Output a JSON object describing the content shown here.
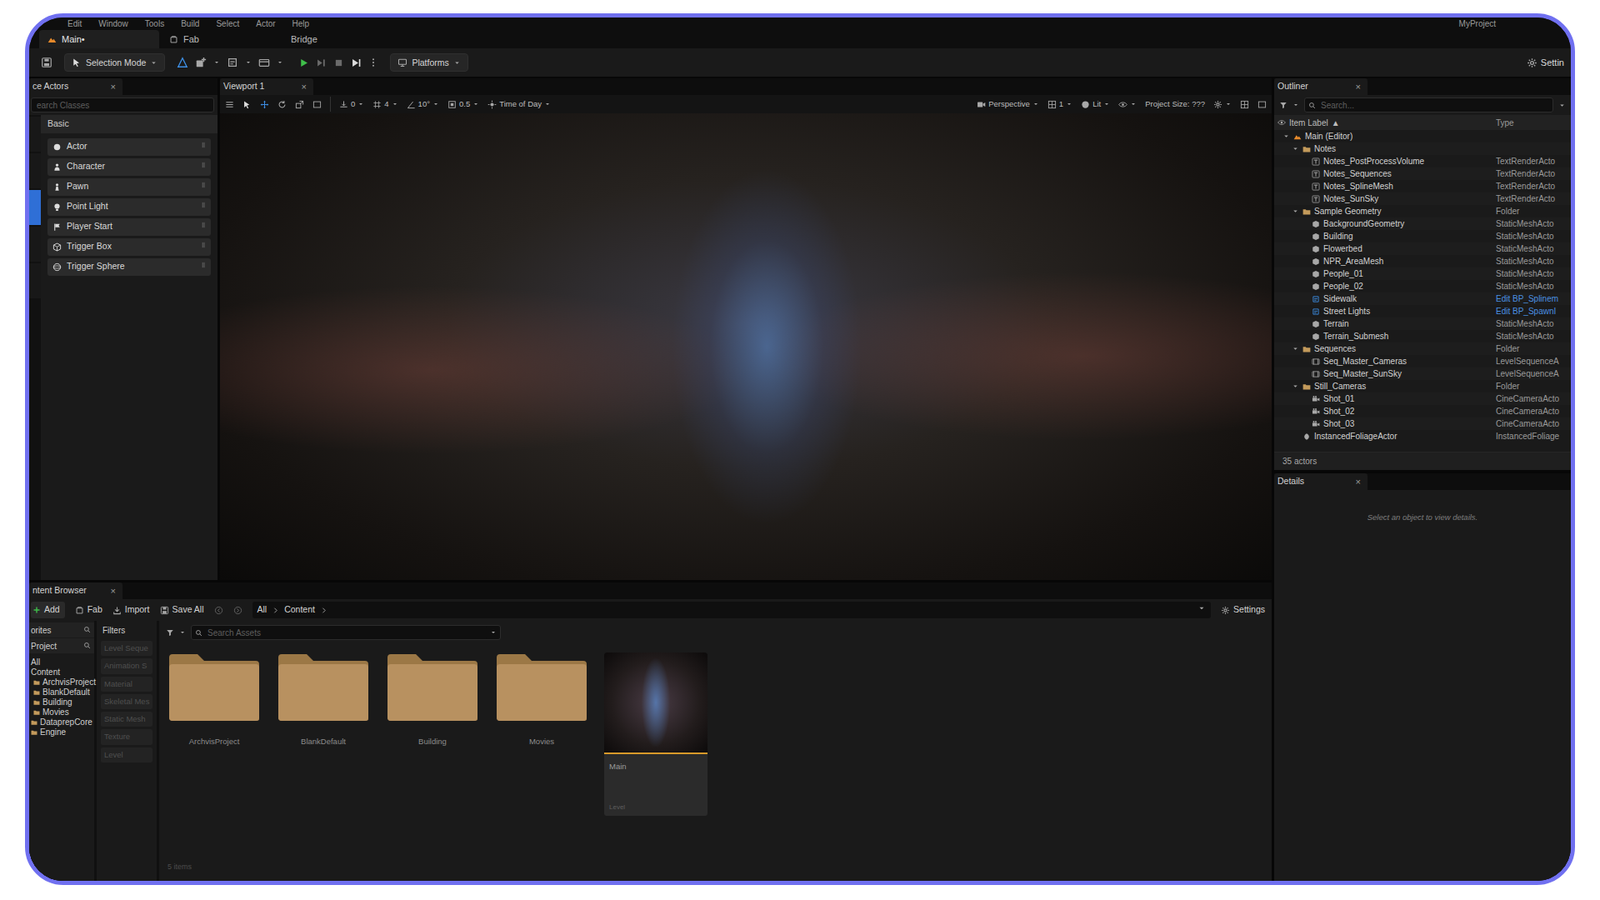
{
  "window": {
    "title": "MyProject"
  },
  "menu": [
    "Edit",
    "Window",
    "Tools",
    "Build",
    "Select",
    "Actor",
    "Help"
  ],
  "doc_tabs": [
    {
      "label": "Main•",
      "selected": true,
      "kind": "level"
    },
    {
      "label": "Fab",
      "selected": false,
      "kind": "fab"
    },
    {
      "label": "Bridge",
      "selected": false,
      "kind": "plain"
    }
  ],
  "toolbar": {
    "mode": "Selection Mode",
    "platforms": "Platforms",
    "settings": "Settin",
    "play_controls": [
      {
        "kind": "play",
        "disabled": false
      },
      {
        "kind": "step",
        "disabled": true
      },
      {
        "kind": "stop",
        "disabled": true
      },
      {
        "kind": "eject",
        "disabled": false
      }
    ]
  },
  "place_actors": {
    "tab": "ce Actors",
    "close": "×",
    "search_placeholder": "earch Classes",
    "category": "Basic",
    "modes": [
      {
        "selected": false
      },
      {
        "selected": false
      },
      {
        "selected": true
      },
      {
        "selected": false
      },
      {
        "selected": false
      }
    ],
    "items": [
      {
        "label": "Actor",
        "kind": "actor"
      },
      {
        "label": "Character",
        "kind": "character"
      },
      {
        "label": "Pawn",
        "kind": "pawn"
      },
      {
        "label": "Point Light",
        "kind": "light"
      },
      {
        "label": "Player Start",
        "kind": "playerstart"
      },
      {
        "label": "Trigger Box",
        "kind": "box"
      },
      {
        "label": "Trigger Sphere",
        "kind": "sphere"
      }
    ]
  },
  "viewport": {
    "tab": "Viewport 1",
    "close": "×",
    "surface_snap": "0",
    "grid_snap": "4",
    "rotate_snap": "10°",
    "scale_snap": "0.5",
    "time_of_day": "Time of Day",
    "view_mode": "Perspective",
    "view_count": "1",
    "lighting": "Lit",
    "project_size": "Project Size: ???"
  },
  "outliner": {
    "tab": "Outliner",
    "close": "×",
    "search_placeholder": "Search...",
    "columns": [
      "Item Label",
      "Type"
    ],
    "sort_glyph": "▲",
    "rows": [
      {
        "label": "Main (Editor)",
        "kind": "level",
        "depth": 0,
        "expanded": true,
        "type_link": false
      },
      {
        "label": "Notes",
        "kind": "folder",
        "depth": 1,
        "expanded": true,
        "type_link": false
      },
      {
        "label": "Notes_PostProcessVolume",
        "type": "TextRenderActo",
        "kind": "text",
        "depth": 2,
        "type_link": false
      },
      {
        "label": "Notes_Sequences",
        "type": "TextRenderActo",
        "kind": "text",
        "depth": 2,
        "type_link": false
      },
      {
        "label": "Notes_SplineMesh",
        "type": "TextRenderActo",
        "kind": "text",
        "depth": 2,
        "type_link": false
      },
      {
        "label": "Notes_SunSky",
        "type": "TextRenderActo",
        "kind": "text",
        "depth": 2,
        "type_link": false
      },
      {
        "label": "Sample Geometry",
        "type": "Folder",
        "kind": "folder",
        "depth": 1,
        "expanded": true,
        "type_link": false
      },
      {
        "label": "BackgroundGeometry",
        "type": "StaticMeshActo",
        "kind": "mesh",
        "depth": 2,
        "type_link": false
      },
      {
        "label": "Building",
        "type": "StaticMeshActo",
        "kind": "mesh",
        "depth": 2,
        "type_link": false
      },
      {
        "label": "Flowerbed",
        "type": "StaticMeshActo",
        "kind": "mesh",
        "depth": 2,
        "type_link": false
      },
      {
        "label": "NPR_AreaMesh",
        "type": "StaticMeshActo",
        "kind": "mesh",
        "depth": 2,
        "type_link": false
      },
      {
        "label": "People_01",
        "type": "StaticMeshActo",
        "kind": "mesh",
        "depth": 2,
        "type_link": false
      },
      {
        "label": "People_02",
        "type": "StaticMeshActo",
        "kind": "mesh",
        "depth": 2,
        "type_link": false
      },
      {
        "label": "Sidewalk",
        "type": "Edit BP_Splinem",
        "kind": "blueprint",
        "depth": 2,
        "type_link": true
      },
      {
        "label": "Street Lights",
        "type": "Edit BP_SpawnI",
        "kind": "blueprint",
        "depth": 2,
        "type_link": true
      },
      {
        "label": "Terrain",
        "type": "StaticMeshActo",
        "kind": "mesh",
        "depth": 2,
        "type_link": false
      },
      {
        "label": "Terrain_Submesh",
        "type": "StaticMeshActo",
        "kind": "mesh",
        "depth": 2,
        "type_link": false
      },
      {
        "label": "Sequences",
        "type": "Folder",
        "kind": "folder",
        "depth": 1,
        "expanded": true,
        "type_link": false
      },
      {
        "label": "Seq_Master_Cameras",
        "type": "LevelSequenceA",
        "kind": "sequence",
        "depth": 2,
        "type_link": false
      },
      {
        "label": "Seq_Master_SunSky",
        "type": "LevelSequenceA",
        "kind": "sequence",
        "depth": 2,
        "type_link": false
      },
      {
        "label": "Still_Cameras",
        "type": "Folder",
        "kind": "folder",
        "depth": 1,
        "expanded": true,
        "type_link": false
      },
      {
        "label": "Shot_01",
        "type": "CineCameraActo",
        "kind": "camera",
        "depth": 2,
        "type_link": false
      },
      {
        "label": "Shot_02",
        "type": "CineCameraActo",
        "kind": "camera",
        "depth": 2,
        "type_link": false
      },
      {
        "label": "Shot_03",
        "type": "CineCameraActo",
        "kind": "camera",
        "depth": 2,
        "type_link": false
      },
      {
        "label": "InstancedFoliageActor",
        "type": "InstancedFoliage",
        "kind": "foliage",
        "depth": 1,
        "type_link": false
      }
    ],
    "count": "35 actors"
  },
  "details": {
    "tab": "Details",
    "close": "×",
    "empty": "Select an object to view details."
  },
  "content_browser": {
    "tab": "ntent Browser",
    "close": "×",
    "toolbar": {
      "add": "Add",
      "fab": "Fab",
      "import": "Import",
      "save_all": "Save All",
      "settings": "Settings"
    },
    "breadcrumb": [
      "All",
      "Content"
    ],
    "sources": {
      "favorites": "orites",
      "project": "Project",
      "tree": [
        {
          "label": "All",
          "kind": "root",
          "depth": 0
        },
        {
          "label": "Content",
          "kind": "root",
          "depth": 0
        },
        {
          "label": "ArchvisProject",
          "kind": "folder",
          "depth": 1
        },
        {
          "label": "BlankDefault",
          "kind": "folder",
          "depth": 1
        },
        {
          "label": "Building",
          "kind": "folder",
          "depth": 1
        },
        {
          "label": "Movies",
          "kind": "folder",
          "depth": 1
        },
        {
          "label": "DataprepCore",
          "kind": "folder",
          "depth": 0
        },
        {
          "label": "Engine",
          "kind": "folder",
          "depth": 0
        }
      ]
    },
    "filters": {
      "title": "Filters",
      "items": [
        "Level Seque",
        "Animation S",
        "Material",
        "Skeletal Mes",
        "Static Mesh",
        "Texture",
        "Level"
      ]
    },
    "search_placeholder": "Search Assets",
    "assets": [
      {
        "label": "ArchvisProject",
        "kind": "folder"
      },
      {
        "label": "BlankDefault",
        "kind": "folder"
      },
      {
        "label": "Building",
        "kind": "folder"
      },
      {
        "label": "Movies",
        "kind": "folder"
      },
      {
        "label": "Main",
        "kind": "level",
        "type": "Level"
      }
    ],
    "count": "5 items"
  }
}
